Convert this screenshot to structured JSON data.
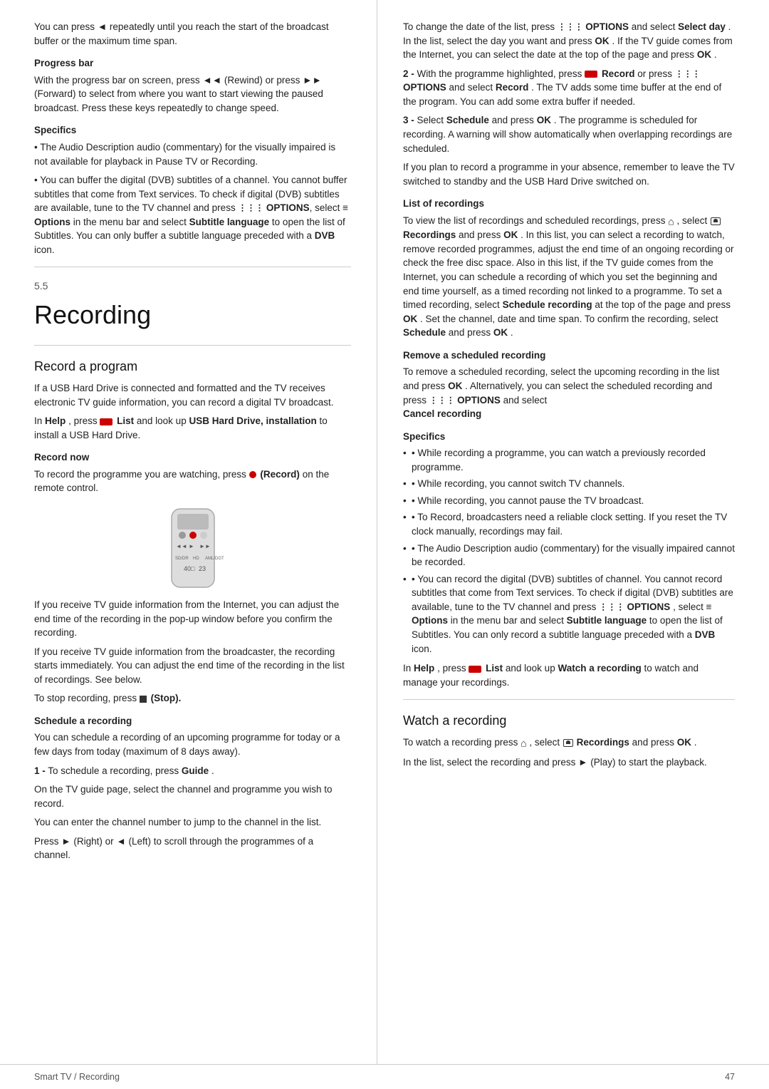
{
  "page": {
    "footer_left": "Smart TV / Recording",
    "footer_right": "47"
  },
  "left_col": {
    "intro_para": "You can press ◄ repeatedly until you reach the start of the broadcast buffer or the maximum time span.",
    "progress_bar_head": "Progress bar",
    "progress_bar_body": "With the progress bar on screen, press ◄◄ (Rewind) or press ►► (Forward) to select from where you want to start viewing the paused broadcast. Press these keys repeatedly to change speed.",
    "specifics_head": "Specifics",
    "specifics_body1": "• The Audio Description audio (commentary) for the visually impaired is not available for playback in Pause TV or Recording.",
    "specifics_body2": "• You can buffer the digital (DVB) subtitles of a channel. You cannot buffer subtitles that come from Text services. To check if digital (DVB) subtitles are available, tune to the TV channel and press",
    "specifics_options": "OPTIONS",
    "specifics_body3": ", select",
    "specifics_eq": "≡ Options",
    "specifics_body4": "in the menu bar and select",
    "specifics_subtitle": "Subtitle language",
    "specifics_body5": "to open the list of Subtitles. You can only buffer a subtitle language preceded with a",
    "specifics_dvb": "DVB",
    "specifics_body6": "icon.",
    "section_num": "5.5",
    "section_title": "Recording",
    "record_program_head": "Record a program",
    "record_program_body1": "If a USB Hard Drive is connected and formatted and the TV receives electronic TV guide information, you can record a digital TV broadcast.",
    "record_program_body2": "In",
    "record_program_help": "Help",
    "record_program_body3": ", press",
    "record_program_list": "List",
    "record_program_body4": "and look up",
    "record_program_usb": "USB Hard Drive, installation",
    "record_program_body5": "to install a USB Hard Drive.",
    "record_now_head": "Record now",
    "record_now_body1": "To record the programme you are watching, press",
    "record_now_dot": "● (Record)",
    "record_now_body2": "on the remote control.",
    "internet_para1": "If you receive TV guide information from the Internet, you can adjust the end time of the recording in the pop-up window before you confirm the recording.",
    "internet_para2": "If you receive TV guide information from the broadcaster, the recording starts immediately. You can adjust the end time of the recording in the list of recordings. See below.",
    "stop_para": "To stop recording, press",
    "stop_sq": "■ (Stop).",
    "schedule_head": "Schedule a recording",
    "schedule_body1": "You can schedule a recording of an upcoming programme for today or a few days from today (maximum of 8 days away).",
    "step1_label": "1 -",
    "step1_body1": "To schedule a recording, press",
    "step1_guide": "Guide",
    "step1_body2": ".",
    "step1_body3": "On the TV guide page, select the channel and programme you wish to record.",
    "step1_body4": "You can enter the channel number to jump to the channel in the list.",
    "step1_body5": "Press ► (Right) or ◄ (Left) to scroll through the programmes of a channel."
  },
  "right_col": {
    "right_intro": "To change the date of the list, press",
    "right_options1": "OPTIONS",
    "right_intro2": "and select",
    "right_selectday": "Select day",
    "right_intro3": ". In the list, select the day you want and press",
    "right_ok1": "OK",
    "right_intro4": ". If the TV guide comes from the Internet, you can select the date at the top of the page and press",
    "right_ok2": "OK",
    "right_intro5": ".",
    "step2_label": "2 -",
    "step2_body1": "With the programme highlighted, press",
    "step2_record": "Record",
    "step2_body2": "or press",
    "step2_options": "OPTIONS",
    "step2_body3": "and select",
    "step2_record2": "Record",
    "step2_body4": ". The TV adds some time buffer at the end of the program. You can add some extra buffer if needed.",
    "step3_label": "3 -",
    "step3_body1": "Select",
    "step3_schedule": "Schedule",
    "step3_body2": "and press",
    "step3_ok": "OK",
    "step3_body3": ". The programme is scheduled for recording. A warning will show automatically when overlapping recordings are scheduled.",
    "step3_body4": "If you plan to record a programme in your absence, remember to leave the TV switched to standby and the USB Hard Drive switched on.",
    "list_rec_head": "List of recordings",
    "list_rec_body1": "To view the list of recordings and scheduled recordings, press",
    "list_rec_home": "⌂",
    "list_rec_body2": ", select",
    "list_rec_recordings": "Recordings",
    "list_rec_body3": "and press",
    "list_rec_ok": "OK",
    "list_rec_body4": ". In this list, you can select a recording to watch, remove recorded programmes, adjust the end time of an ongoing recording or check the free disc space. Also in this list, if the TV guide comes from the Internet, you can schedule a recording of which you set the beginning and end time yourself, as a timed recording not linked to a programme. To set a timed recording, select",
    "list_rec_schedule": "Schedule recording",
    "list_rec_body5": "at the top of the page and press",
    "list_rec_ok2": "OK",
    "list_rec_body6": ". Set the channel, date and time span. To confirm the recording, select",
    "list_rec_schedule2": "Schedule",
    "list_rec_body7": "and press",
    "list_rec_ok3": "OK",
    "list_rec_body8": ".",
    "remove_head": "Remove a scheduled recording",
    "remove_body1": "To remove a scheduled recording, select the upcoming recording in the list and press",
    "remove_ok": "OK",
    "remove_body2": ". Alternatively, you can select the scheduled recording and press",
    "remove_options": "OPTIONS",
    "remove_body3": "and select",
    "remove_cancel": "Cancel recording",
    "remove_body4": ".",
    "specifics_head": "Specifics",
    "spec1": "• While recording a programme, you can watch a previously recorded programme.",
    "spec2": "• While recording, you cannot switch TV channels.",
    "spec3": "• While recording, you cannot pause the TV broadcast.",
    "spec4": "• To Record, broadcasters need a reliable clock setting. If you reset the TV clock manually, recordings may fail.",
    "spec5": "• The Audio Description audio (commentary) for the visually impaired cannot be recorded.",
    "spec6": "• You can record the digital (DVB) subtitles of channel. You cannot record subtitles that come from Text services. To check if digital (DVB) subtitles are available, tune to the TV channel and press",
    "spec6_options": "OPTIONS",
    "spec6_body2": ", select",
    "spec6_eq": "≡ Options",
    "spec6_body3": "in the menu bar and select",
    "spec6_subtitle": "Subtitle language",
    "spec6_body4": "to open the list of Subtitles. You can only record a subtitle language preceded with a",
    "spec6_dvb": "DVB",
    "spec6_body5": "icon.",
    "help_para1": "In",
    "help_bold": "Help",
    "help_para2": ", press",
    "help_list": "List",
    "help_para3": "and look up",
    "help_watch": "Watch a recording",
    "help_para4": "to watch and manage your recordings.",
    "watch_head": "Watch a recording",
    "watch_body1": "To watch a recording press",
    "watch_home": "⌂",
    "watch_body2": ", select",
    "watch_recordings": "Recordings",
    "watch_body3": "and press",
    "watch_ok": "OK",
    "watch_body4": ".",
    "watch_body5": "In the list, select the recording and press ► (Play) to start the playback."
  }
}
